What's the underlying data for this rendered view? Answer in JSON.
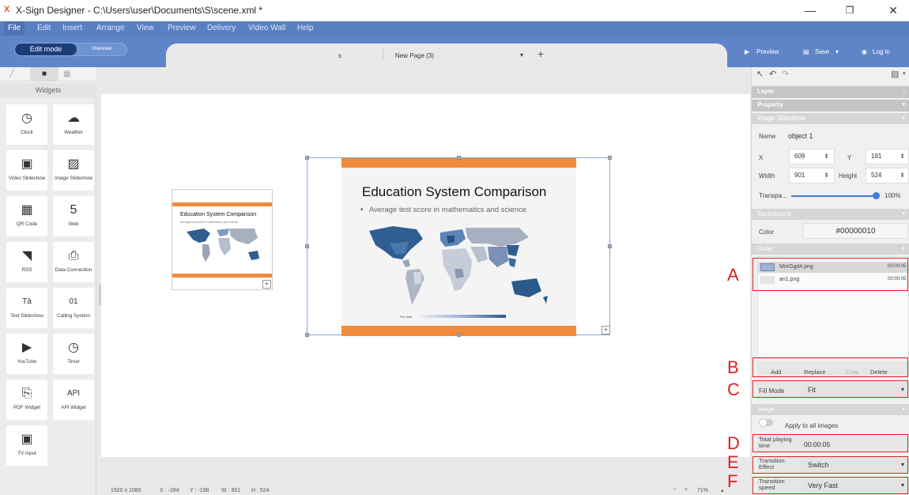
{
  "window": {
    "title": "X-Sign Designer - C:\\Users\\user\\Documents\\S\\scene.xml *",
    "app_icon": "X",
    "min": "—",
    "max": "❐",
    "close": "✕"
  },
  "menu": [
    "File",
    "Edit",
    "Insert",
    "Arrange",
    "View",
    "Preview",
    "Delivery",
    "Video Wall",
    "Help"
  ],
  "mode": {
    "edit": "Edit mode",
    "overview": "Overview"
  },
  "doc": {
    "tab_name": "s",
    "page": "New Page (3)",
    "add": "+",
    "dropdown": "▾"
  },
  "toolbar_right": {
    "preview": "Preview",
    "save": "Save",
    "login": "Log in"
  },
  "left": {
    "header": "Widgets",
    "widgets": [
      {
        "label": "Clock",
        "icon": "clock-icon",
        "glyph": "◷"
      },
      {
        "label": "Weather",
        "icon": "weather-icon",
        "glyph": "☁"
      },
      {
        "label": "Video Slideshow",
        "icon": "video-slideshow-icon",
        "glyph": "▣"
      },
      {
        "label": "Image Slideshow",
        "icon": "image-slideshow-icon",
        "glyph": "▨"
      },
      {
        "label": "QR Code",
        "icon": "qr-code-icon",
        "glyph": "▦"
      },
      {
        "label": "Web",
        "icon": "html5-icon",
        "glyph": "5"
      },
      {
        "label": "RSS",
        "icon": "rss-icon",
        "glyph": "◥"
      },
      {
        "label": "Data Connection",
        "icon": "data-connection-icon",
        "glyph": "⎙"
      },
      {
        "label": "Text Slideshow",
        "icon": "text-slideshow-icon",
        "glyph": "Tä"
      },
      {
        "label": "Calling System",
        "icon": "calling-system-icon",
        "glyph": "01"
      },
      {
        "label": "YouTube",
        "icon": "youtube-icon",
        "glyph": "▶"
      },
      {
        "label": "Timer",
        "icon": "timer-icon",
        "glyph": "◷"
      },
      {
        "label": "PDF Widget",
        "icon": "pdf-icon",
        "glyph": "⎘"
      },
      {
        "label": "API Widget",
        "icon": "api-icon",
        "glyph": "API"
      },
      {
        "label": "TV Input",
        "icon": "tv-input-icon",
        "glyph": "▣"
      }
    ]
  },
  "slide": {
    "title": "Education System Comparison",
    "bullet": "Average test score in mathematics and science",
    "legend_label": "Per data"
  },
  "status": {
    "resolution": "1920 x 1080",
    "x": "X : -284",
    "y": "Y : -198",
    "w": "W : 901",
    "h": "H : 524",
    "zoom_minus": "−",
    "zoom_plus": "+",
    "zoom": "71%"
  },
  "right": {
    "layer": "Layer",
    "property": "Property",
    "widget_type": "Image Slideshow",
    "name_label": "Name",
    "name_value": "object 1",
    "x_label": "X",
    "x_value": "609",
    "y_label": "Y",
    "y_value": "191",
    "width_label": "Width",
    "width_value": "901",
    "height_label": "Height",
    "height_value": "524",
    "transp_label": "Transpa...",
    "transp_value": "100%",
    "transp_fraction": 1.0,
    "background": "Background",
    "color_label": "Color",
    "color_value": "#00000010",
    "order": "Order",
    "images": [
      {
        "name": "MrirGgd4.png",
        "time": "00:00:05"
      },
      {
        "name": "an1.png",
        "time": "00:00:05"
      }
    ],
    "add": "Add",
    "replace": "Replace",
    "crop": "Crop",
    "delete": "Delete",
    "fill_mode_label": "Fill Mode",
    "fill_mode_value": "Fit",
    "image": "Image",
    "apply_all": "Apply to all images",
    "total_label": "Total playing time",
    "total_value": "00:00:05",
    "trans_effect_label": "Transition Effect",
    "trans_effect_value": "Switch",
    "trans_speed_label": "Transition speed",
    "trans_speed_value": "Very Fast"
  },
  "annotations": [
    "A",
    "B",
    "C",
    "D",
    "E",
    "F"
  ]
}
